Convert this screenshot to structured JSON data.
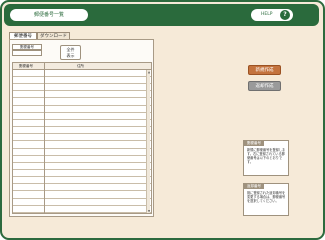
{
  "header": {
    "title": "郵便番号一覧",
    "help_label": "HELP",
    "help_icon": "?"
  },
  "tabs": [
    {
      "label": "郵便番号",
      "active": true
    },
    {
      "label": "ダウンロード",
      "active": false
    }
  ],
  "search": {
    "field_label": "郵便番号",
    "field_value": "",
    "button_line1": "全件",
    "button_line2": "表示"
  },
  "table": {
    "columns": [
      "郵便番号",
      "住所"
    ],
    "row_count": 20
  },
  "buttons": {
    "new_label": "新規作成",
    "return_label": "返却作成"
  },
  "notes": [
    {
      "title": "郵便番号",
      "body": "新規に郵便番号を登録します。右に登録されている郵便番号は以下のとおりです。"
    },
    {
      "title": "返却番号",
      "body": "既に登録された返却番号を変更する場合は、郵便番号を選択してください。"
    }
  ],
  "colors": {
    "header_green": "#2a6a3c",
    "background": "#f6ead8",
    "new_button": "#c4733e",
    "return_button": "#9a9a9a"
  }
}
